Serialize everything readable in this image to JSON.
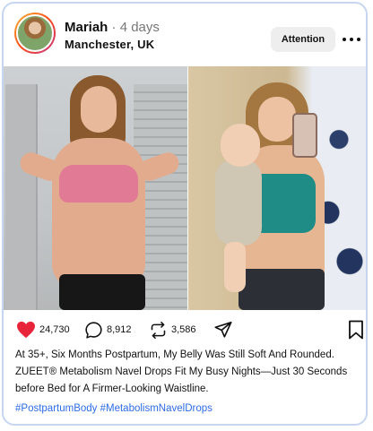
{
  "post": {
    "author": {
      "username": "Mariah",
      "separator": "·",
      "time": "4 days",
      "location": "Manchester, UK"
    },
    "attention_label": "Attention",
    "photos": [
      {
        "icon": "before-photo"
      },
      {
        "icon": "after-photo-with-baby"
      }
    ],
    "actions": {
      "likes": "24,730",
      "comments": "8,912",
      "shares": "3,586"
    },
    "caption": "At 35+, Six Months Postpartum, My Belly Was Still Soft And Rounded. ZUEET® Metabolism Navel Drops Fit My Busy Nights—Just 30 Seconds before Bed for A Firmer-Looking Waistline.",
    "hashtags": "#PostpartumBody #MetabolismNavelDrops"
  },
  "colors": {
    "like": "#e8243a",
    "hashtag": "#2e6ce6",
    "card_border": "#c7d6f0"
  }
}
